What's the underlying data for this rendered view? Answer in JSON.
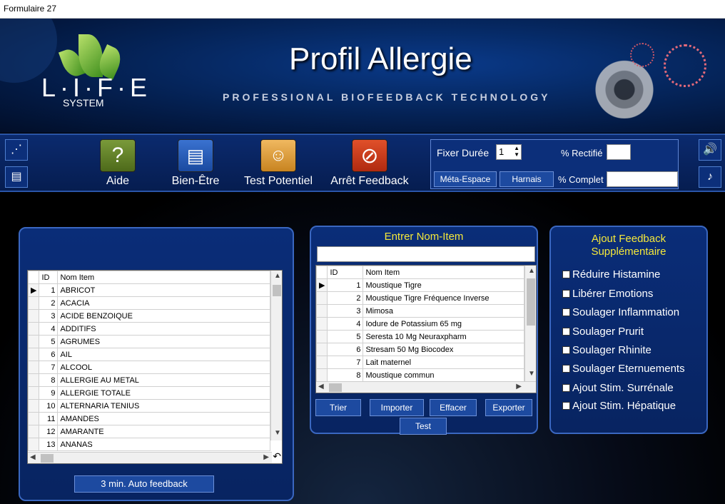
{
  "window": {
    "title": "Formulaire 27"
  },
  "header": {
    "title": "Profil Allergie",
    "tagline": "PROFESSIONAL BIOFEEDBACK TECHNOLOGY",
    "logo_text": "L·I·F·E",
    "logo_sub": "SYSTEM"
  },
  "toolbar": {
    "aide": "Aide",
    "bien_etre": "Bien-Être",
    "test_potentiel": "Test Potentiel",
    "arret_feedback": "Arrêt Feedback"
  },
  "duration": {
    "fixer_label": "Fixer Durée",
    "fixer_value": "1",
    "rectifie_label": "% Rectifié",
    "complet_label": "% Complet",
    "meta_espace": "Méta-Espace",
    "harnais": "Harnais"
  },
  "left_grid": {
    "col_id": "ID",
    "col_name": "Nom Item",
    "rows": [
      {
        "id": "1",
        "name": "ABRICOT"
      },
      {
        "id": "2",
        "name": "ACACIA"
      },
      {
        "id": "3",
        "name": "ACIDE BENZOIQUE"
      },
      {
        "id": "4",
        "name": "ADDITIFS"
      },
      {
        "id": "5",
        "name": "AGRUMES"
      },
      {
        "id": "6",
        "name": "AIL"
      },
      {
        "id": "7",
        "name": "ALCOOL"
      },
      {
        "id": "8",
        "name": "ALLERGIE AU METAL"
      },
      {
        "id": "9",
        "name": "ALLERGIE TOTALE"
      },
      {
        "id": "10",
        "name": "ALTERNARIA TENIUS"
      },
      {
        "id": "11",
        "name": "AMANDES"
      },
      {
        "id": "12",
        "name": "AMARANTE"
      },
      {
        "id": "13",
        "name": "ANANAS"
      }
    ],
    "auto_feedback": "3 min. Auto feedback"
  },
  "middle": {
    "title": "Entrer Nom-Item",
    "input_value": "",
    "col_id": "ID",
    "col_name": "Nom Item",
    "rows": [
      {
        "id": "1",
        "name": "Moustique Tigre"
      },
      {
        "id": "2",
        "name": "Moustique Tigre Fréquence Inverse"
      },
      {
        "id": "3",
        "name": "Mimosa"
      },
      {
        "id": "4",
        "name": "Iodure de Potassium 65 mg"
      },
      {
        "id": "5",
        "name": "Seresta 10 Mg Neuraxpharm"
      },
      {
        "id": "6",
        "name": "Stresam 50 Mg Biocodex"
      },
      {
        "id": "7",
        "name": "Lait maternel"
      },
      {
        "id": "8",
        "name": "Moustique commun"
      }
    ],
    "trier": "Trier",
    "importer": "Importer",
    "effacer": "Effacer",
    "exporter": "Exporter",
    "test": "Test"
  },
  "feedback": {
    "title_line1": "Ajout Feedback",
    "title_line2": "Supplémentaire",
    "options": [
      "Réduire Histamine",
      "Libérer Emotions",
      "Soulager Inflammation",
      "Soulager Prurit",
      "Soulager Rhinite",
      "Soulager Eternuements",
      "Ajout Stim. Surrénale",
      "Ajout Stim. Hépatique"
    ]
  },
  "colors": {
    "accent_yellow": "#f5e83a",
    "panel_blue": "#0a2d78",
    "border_blue": "#3a67c0"
  }
}
